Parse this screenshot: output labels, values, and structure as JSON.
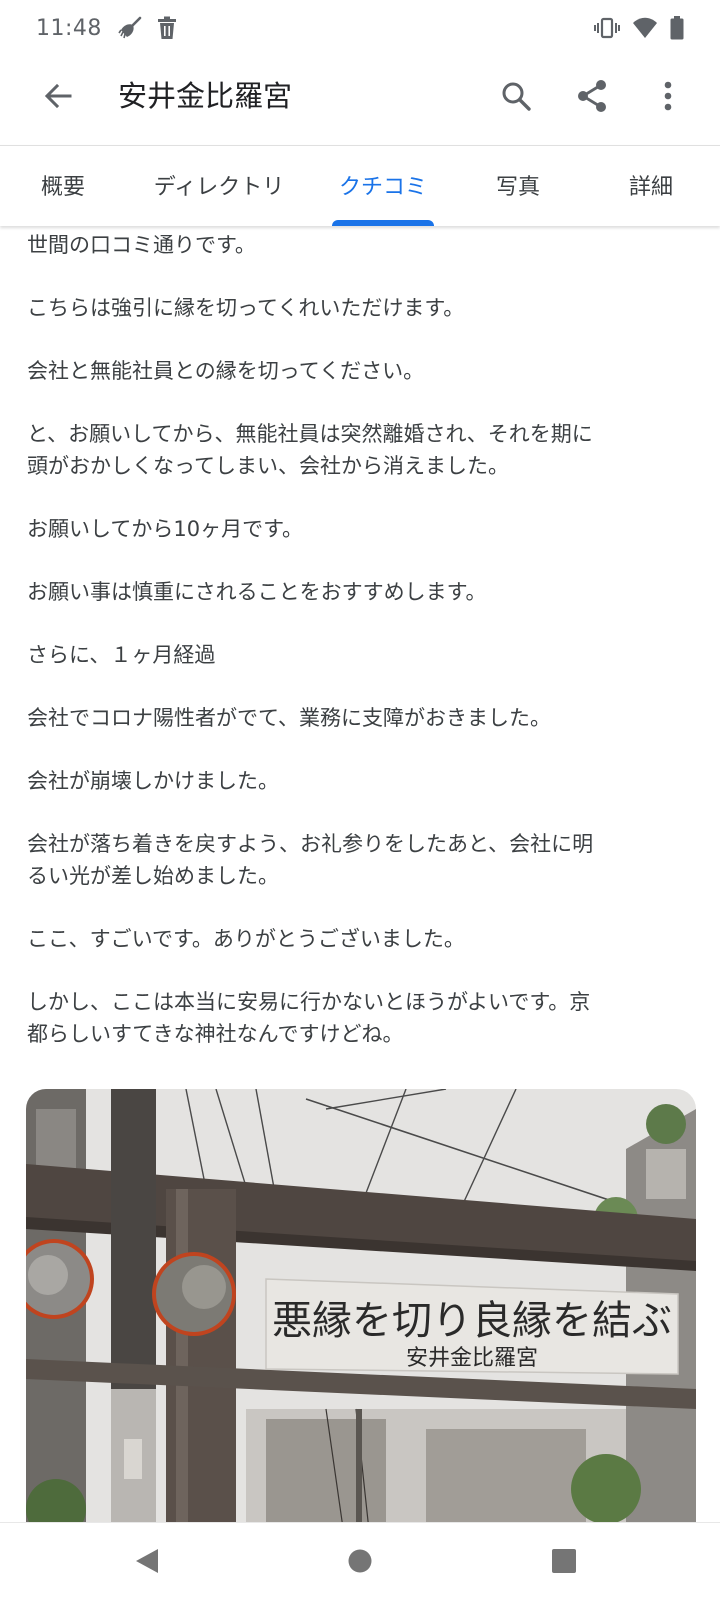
{
  "status_bar": {
    "time": "11:48",
    "left_icons": [
      "broom-icon",
      "trash-icon"
    ],
    "right_icons": [
      "vibrate-icon",
      "wifi-icon",
      "battery-icon"
    ]
  },
  "app_bar": {
    "title": "安井金比羅宮",
    "back_icon": "arrow-back-icon",
    "actions": [
      "search-icon",
      "share-icon",
      "more-vert-icon"
    ]
  },
  "tabs": [
    {
      "label": "概要",
      "active": false
    },
    {
      "label": "ディレクトリ",
      "active": false
    },
    {
      "label": "クチコミ",
      "active": true
    },
    {
      "label": "写真",
      "active": false
    },
    {
      "label": "詳細",
      "active": false
    }
  ],
  "review": {
    "paragraphs": [
      "世間の口コミ通りです。",
      "こちらは強引に縁を切ってくれいただけます。",
      "会社と無能社員との縁を切ってください。",
      "と、お願いしてから、無能社員は突然離婚され、それを期に\n頭がおかしくなってしまい、会社から消えました。",
      "お願いしてから10ヶ月です。",
      "お願い事は慎重にされることをおすすめします。",
      "さらに、１ヶ月経過",
      "会社でコロナ陽性者がでて、業務に支障がおきました。",
      "会社が崩壊しかけました。",
      "会社が落ち着きを戻すよう、お礼参りをしたあと、会社に明\nるい光が差し始めました。",
      "ここ、すごいです。ありがとうございました。",
      "しかし、ここは本当に安易に行かないとほうがよいです。京\n都らしいすてきな神社なんですけどね。"
    ],
    "photo": {
      "banner_main": "悪縁を切り良縁を結ぶ",
      "banner_sub": "安井金比羅宮"
    }
  },
  "colors": {
    "accent": "#1a73e8",
    "text_primary": "#202124",
    "text_body": "#3c4043",
    "icon_gray": "#5f6368"
  },
  "nav_bar": {
    "buttons": [
      "back-triangle-icon",
      "home-circle-icon",
      "recents-square-icon"
    ]
  }
}
